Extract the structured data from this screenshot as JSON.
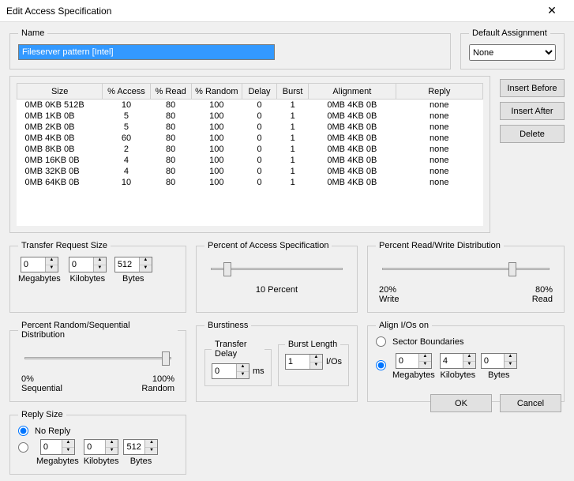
{
  "window": {
    "title": "Edit Access Specification",
    "close": "✕"
  },
  "name": {
    "legend": "Name",
    "value": "Fileserver pattern [Intel]"
  },
  "default_assignment": {
    "legend": "Default Assignment",
    "selected": "None"
  },
  "table": {
    "headers": [
      "Size",
      "% Access",
      "% Read",
      "% Random",
      "Delay",
      "Burst",
      "Alignment",
      "Reply"
    ],
    "rows": [
      {
        "size": "0MB   0KB 512B",
        "access": "10",
        "read": "80",
        "random": "100",
        "delay": "0",
        "burst": "1",
        "alignment": "0MB   4KB   0B",
        "reply": "none"
      },
      {
        "size": "0MB   1KB   0B",
        "access": "5",
        "read": "80",
        "random": "100",
        "delay": "0",
        "burst": "1",
        "alignment": "0MB   4KB   0B",
        "reply": "none"
      },
      {
        "size": "0MB   2KB   0B",
        "access": "5",
        "read": "80",
        "random": "100",
        "delay": "0",
        "burst": "1",
        "alignment": "0MB   4KB   0B",
        "reply": "none"
      },
      {
        "size": "0MB   4KB   0B",
        "access": "60",
        "read": "80",
        "random": "100",
        "delay": "0",
        "burst": "1",
        "alignment": "0MB   4KB   0B",
        "reply": "none"
      },
      {
        "size": "0MB   8KB   0B",
        "access": "2",
        "read": "80",
        "random": "100",
        "delay": "0",
        "burst": "1",
        "alignment": "0MB   4KB   0B",
        "reply": "none"
      },
      {
        "size": "0MB  16KB   0B",
        "access": "4",
        "read": "80",
        "random": "100",
        "delay": "0",
        "burst": "1",
        "alignment": "0MB   4KB   0B",
        "reply": "none"
      },
      {
        "size": "0MB  32KB   0B",
        "access": "4",
        "read": "80",
        "random": "100",
        "delay": "0",
        "burst": "1",
        "alignment": "0MB   4KB   0B",
        "reply": "none"
      },
      {
        "size": "0MB  64KB   0B",
        "access": "10",
        "read": "80",
        "random": "100",
        "delay": "0",
        "burst": "1",
        "alignment": "0MB   4KB   0B",
        "reply": "none"
      }
    ]
  },
  "side_buttons": {
    "insert_before": "Insert Before",
    "insert_after": "Insert After",
    "delete": "Delete"
  },
  "transfer_request_size": {
    "legend": "Transfer Request Size",
    "megabytes": {
      "value": "0",
      "label": "Megabytes"
    },
    "kilobytes": {
      "value": "0",
      "label": "Kilobytes"
    },
    "bytes": {
      "value": "512",
      "label": "Bytes"
    }
  },
  "percent_access": {
    "legend": "Percent of Access Specification",
    "caption": "10 Percent",
    "pos_pct": 10
  },
  "percent_rw": {
    "legend": "Percent Read/Write Distribution",
    "left_val": "20%",
    "left_lab": "Write",
    "right_val": "80%",
    "right_lab": "Read",
    "pos_pct": 80
  },
  "percent_random": {
    "legend": "Percent Random/Sequential Distribution",
    "left_val": "0%",
    "left_lab": "Sequential",
    "right_val": "100%",
    "right_lab": "Random",
    "pos_pct": 100
  },
  "burstiness": {
    "legend": "Burstiness",
    "transfer_delay": {
      "legend": "Transfer Delay",
      "value": "0",
      "unit": "ms"
    },
    "burst_length": {
      "legend": "Burst Length",
      "value": "1",
      "unit": "I/Os"
    }
  },
  "align": {
    "legend": "Align I/Os on",
    "sector_label": "Sector Boundaries",
    "megabytes": {
      "value": "0",
      "label": "Megabytes"
    },
    "kilobytes": {
      "value": "4",
      "label": "Kilobytes"
    },
    "bytes": {
      "value": "0",
      "label": "Bytes"
    }
  },
  "reply": {
    "legend": "Reply Size",
    "no_reply": "No Reply",
    "megabytes": {
      "value": "0",
      "label": "Megabytes"
    },
    "kilobytes": {
      "value": "0",
      "label": "Kilobytes"
    },
    "bytes": {
      "value": "512",
      "label": "Bytes"
    }
  },
  "dialog": {
    "ok": "OK",
    "cancel": "Cancel"
  }
}
